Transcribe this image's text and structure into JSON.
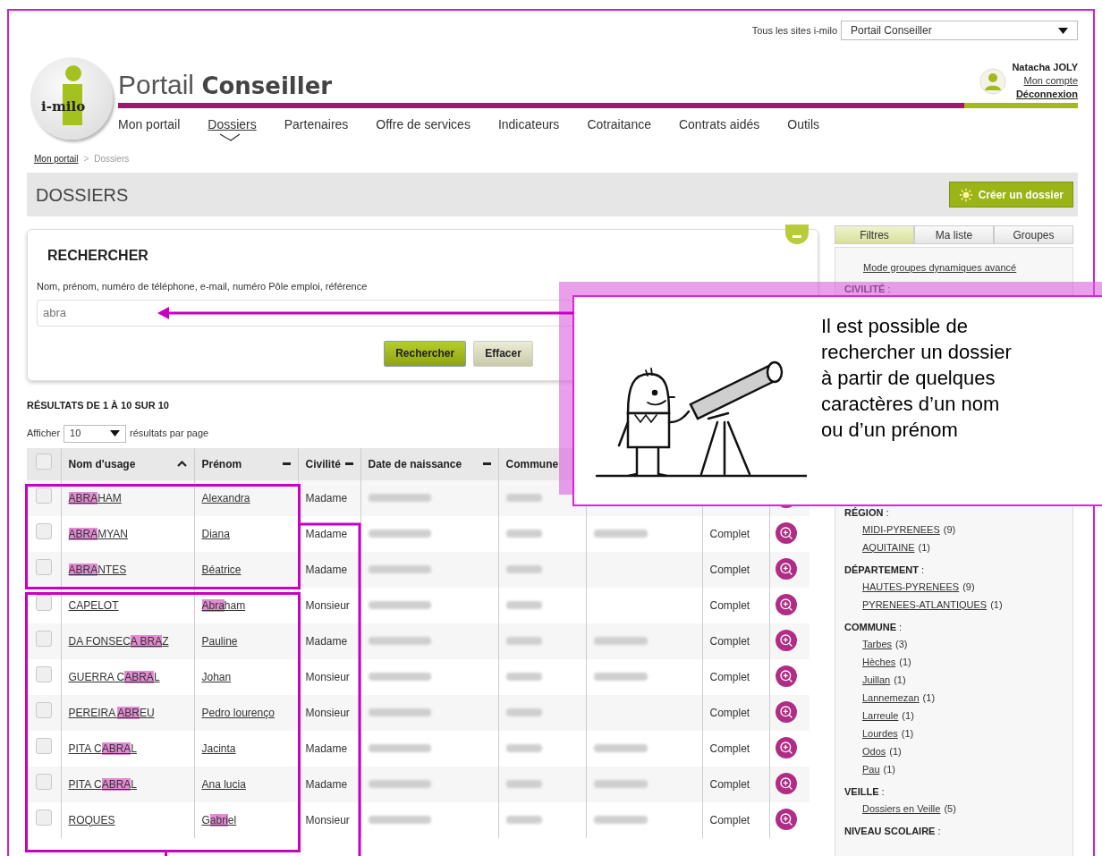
{
  "top_bar": {
    "site_label": "Tous les sites i-milo",
    "site_select": "Portail Conseiller"
  },
  "logo": {
    "text": "i-milo"
  },
  "title": {
    "light": "Portail",
    "bold": "Conseiller"
  },
  "user": {
    "name": "Natacha JOLY",
    "account_link": "Mon compte",
    "logout_link": "Déconnexion"
  },
  "nav": [
    {
      "label": "Mon portail",
      "selected": false
    },
    {
      "label": "Dossiers",
      "selected": true
    },
    {
      "label": "Partenaires",
      "selected": false
    },
    {
      "label": "Offre de services",
      "selected": false
    },
    {
      "label": "Indicateurs",
      "selected": false
    },
    {
      "label": "Cotraitance",
      "selected": false
    },
    {
      "label": "Contrats aidés",
      "selected": false
    },
    {
      "label": "Outils",
      "selected": false
    }
  ],
  "breadcrumb": {
    "separator": ">",
    "items": [
      {
        "label": "Mon portail",
        "current": false
      },
      {
        "label": "Dossiers",
        "current": true
      }
    ]
  },
  "page_title": "DOSSIERS",
  "create_button": "Créer un dossier",
  "search": {
    "title": "RECHERCHER",
    "label": "Nom, prénom, numéro de téléphone, e-mail, numéro Pôle emploi, référence",
    "value": "abra",
    "buttons": [
      {
        "label": "Rechercher",
        "kind": "primary"
      },
      {
        "label": "Effacer",
        "kind": "secondary"
      }
    ]
  },
  "results": {
    "summary": "RÉSULTATS DE 1 À 10 SUR 10",
    "show_label": "Afficher",
    "page_size": "10",
    "per_page_label": "résultats par page"
  },
  "table": {
    "select_all_checked": false,
    "columns": [
      {
        "label": "Nom d'usage",
        "sorted": true
      },
      {
        "label": "Prénom",
        "sorted": false
      },
      {
        "label": "Civilité",
        "sorted": false
      },
      {
        "label": "Date de naissance",
        "sorted": false
      },
      {
        "label": "Commune"
      }
    ],
    "rows": [
      {
        "checked": false,
        "name": [
          {
            "text": "ABRA",
            "highlighted": true
          },
          {
            "text": "HAM",
            "highlighted": false
          }
        ],
        "first_name": [
          {
            "text": "Alexandra",
            "highlighted": false
          }
        ],
        "civility": "Madame"
      },
      {
        "checked": false,
        "name": [
          {
            "text": "ABRA",
            "highlighted": true
          },
          {
            "text": "MYAN",
            "highlighted": false
          }
        ],
        "first_name": [
          {
            "text": "Diana",
            "highlighted": false
          }
        ],
        "civility": "Madame",
        "phone_shown": true,
        "status": "Complet"
      },
      {
        "checked": false,
        "name": [
          {
            "text": "ABRA",
            "highlighted": true
          },
          {
            "text": "NTES",
            "highlighted": false
          }
        ],
        "first_name": [
          {
            "text": "Béatrice",
            "highlighted": false
          }
        ],
        "civility": "Madame",
        "phone_shown": false,
        "status": "Complet"
      },
      {
        "checked": false,
        "name": [
          {
            "text": "CAPELOT",
            "highlighted": false
          }
        ],
        "first_name": [
          {
            "text": "Abra",
            "highlighted": true
          },
          {
            "text": "ham",
            "highlighted": false
          }
        ],
        "civility": "Monsieur",
        "phone_shown": false,
        "status": "Complet"
      },
      {
        "checked": false,
        "name": [
          {
            "text": "DA FONSEC",
            "highlighted": false
          },
          {
            "text": "A BRA",
            "highlighted": true
          },
          {
            "text": "Z",
            "highlighted": false
          }
        ],
        "first_name": [
          {
            "text": "Pauline",
            "highlighted": false
          }
        ],
        "civility": "Madame",
        "phone_shown": true,
        "status": "Complet"
      },
      {
        "checked": false,
        "name": [
          {
            "text": "GUERRA C",
            "highlighted": false
          },
          {
            "text": "ABRA",
            "highlighted": true
          },
          {
            "text": "L",
            "highlighted": false
          }
        ],
        "first_name": [
          {
            "text": "Johan",
            "highlighted": false
          }
        ],
        "civility": "Monsieur",
        "phone_shown": true,
        "status": "Complet"
      },
      {
        "checked": false,
        "name": [
          {
            "text": "PEREIRA ",
            "highlighted": false
          },
          {
            "text": "ABR",
            "highlighted": true
          },
          {
            "text": "EU",
            "highlighted": false
          }
        ],
        "first_name": [
          {
            "text": "Pedro lourenço",
            "highlighted": false
          }
        ],
        "civility": "Monsieur",
        "phone_shown": false,
        "status": "Complet"
      },
      {
        "checked": false,
        "name": [
          {
            "text": "PITA C",
            "highlighted": false
          },
          {
            "text": "ABRA",
            "highlighted": true
          },
          {
            "text": "L",
            "highlighted": false
          }
        ],
        "first_name": [
          {
            "text": "Jacinta",
            "highlighted": false
          }
        ],
        "civility": "Madame",
        "phone_shown": true,
        "status": "Complet"
      },
      {
        "checked": false,
        "name": [
          {
            "text": "PITA C",
            "highlighted": false
          },
          {
            "text": "ABRA",
            "highlighted": true
          },
          {
            "text": "L",
            "highlighted": false
          }
        ],
        "first_name": [
          {
            "text": "Ana lucia",
            "highlighted": false
          }
        ],
        "civility": "Madame",
        "phone_shown": true,
        "status": "Complet"
      },
      {
        "checked": false,
        "name": [
          {
            "text": "ROQUES",
            "highlighted": false
          }
        ],
        "first_name": [
          {
            "text": "G",
            "highlighted": false
          },
          {
            "text": "abri",
            "highlighted": true
          },
          {
            "text": "el",
            "highlighted": false
          }
        ],
        "civility": "Monsieur",
        "phone_shown": true,
        "status": "Complet"
      }
    ]
  },
  "sidebar": {
    "tabs": [
      {
        "label": "Filtres",
        "selected": true
      },
      {
        "label": "Ma liste",
        "selected": false
      },
      {
        "label": "Groupes",
        "selected": false
      }
    ],
    "advanced_link": "Mode groupes dynamiques avancé",
    "sections": [
      {
        "title": "**CIVILITÉ** :"
      },
      {
        "title": "**RÉGION** :",
        "items": [
          {
            "label": "MIDI-PYRENEES",
            "count": "(9)"
          },
          {
            "label": "AQUITAINE",
            "count": "(1)"
          }
        ]
      },
      {
        "title": "**DÉPARTEMENT** :",
        "items": [
          {
            "label": "HAUTES-PYRENEES",
            "count": "(9)"
          },
          {
            "label": "PYRENEES-ATLANTIQUES",
            "count": "(1)"
          }
        ]
      },
      {
        "title": "**COMMUNE** :",
        "items": [
          {
            "label": "Tarbes",
            "count": "(3)"
          },
          {
            "label": "Hèches",
            "count": "(1)"
          },
          {
            "label": "Juillan",
            "count": "(1)"
          },
          {
            "label": "Lannemezan",
            "count": "(1)"
          },
          {
            "label": "Larreule",
            "count": "(1)"
          },
          {
            "label": "Lourdes",
            "count": "(1)"
          },
          {
            "label": "Odos",
            "count": "(1)"
          },
          {
            "label": "Pau",
            "count": "(1)"
          }
        ]
      },
      {
        "title": "**VEILLE** :",
        "items": [
          {
            "label": "Dossiers en Veille",
            "count": "(5)"
          }
        ]
      },
      {
        "title": "**NIVEAU SCOLAIRE** :"
      }
    ]
  },
  "callout": {
    "text": "Il est possible de rechercher un dossier à partir de quelques caractères d’un nom ou d’un prénom"
  }
}
